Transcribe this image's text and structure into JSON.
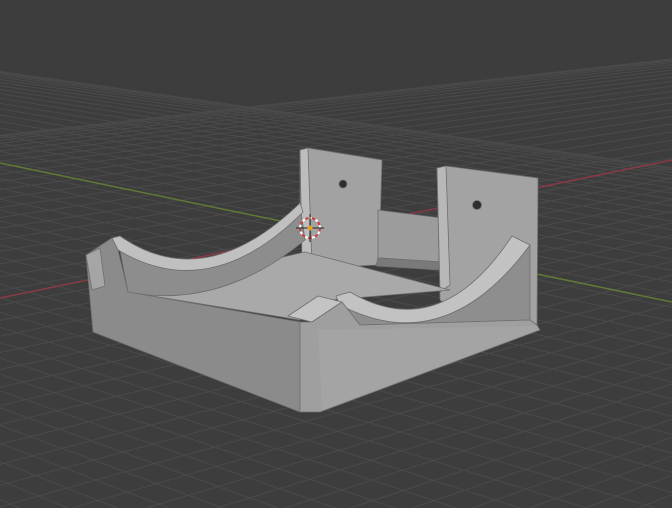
{
  "viewport": {
    "background": "#3d3d3d",
    "grid_color": "#4a4a4a",
    "x_axis_color": "#8a3a44",
    "y_axis_color": "#5f7a36"
  },
  "model": {
    "face_light": "#a7a7a7",
    "face_mid": "#979797",
    "face_dark": "#7f7f7f",
    "edge": "#6a6a6a"
  },
  "cursor": {
    "ring_color": "#d04040",
    "center_color": "#e8a020"
  }
}
